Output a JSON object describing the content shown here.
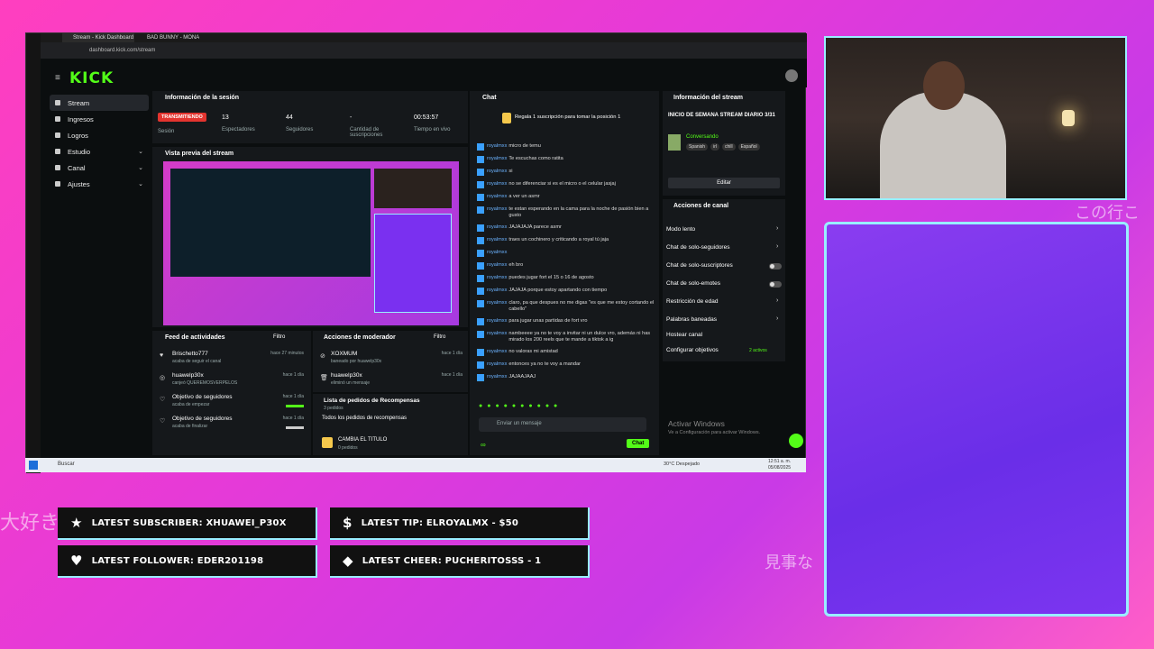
{
  "browser": {
    "tabs": [
      "Stream - Kick Dashboard",
      "BAD BUNNY - MONA..."
    ],
    "url": "dashboard.kick.com/stream"
  },
  "nav": {
    "logo": "KICK",
    "items": [
      {
        "label": "Stream",
        "active": true
      },
      {
        "label": "Ingresos"
      },
      {
        "label": "Logros"
      },
      {
        "label": "Estudio",
        "chevron": "⌄"
      },
      {
        "label": "Canal",
        "chevron": "⌄"
      },
      {
        "label": "Ajustes",
        "chevron": "⌄"
      }
    ]
  },
  "session": {
    "title": "Información de la sesión",
    "status": "TRANSMITIENDO",
    "status_label": "Sesión",
    "stats": [
      {
        "value": "13",
        "label": "Espectadores"
      },
      {
        "value": "44",
        "label": "Seguidores"
      },
      {
        "value": "-",
        "label": "Cantidad de suscripciones"
      },
      {
        "value": "00:53:57",
        "label": "Tiempo en vivo"
      }
    ]
  },
  "preview": {
    "title": "Vista previa del stream"
  },
  "activity": {
    "title": "Feed de actividades",
    "filter": "Filtro",
    "items": [
      {
        "name": "Brischetto777",
        "detail": "acaba de seguir el canal",
        "time": "hace 27 minutos"
      },
      {
        "name": "huawelp30x",
        "detail": "canjeó QUEREMOSVERPELOS",
        "time": "hace 1 día"
      },
      {
        "name": "Objetivo de seguidores",
        "detail": "acaba de empezar",
        "time": "hace 1 día"
      },
      {
        "name": "Objetivo de seguidores",
        "detail": "acaba de finalizar",
        "time": "hace 1 día"
      }
    ]
  },
  "moderator": {
    "title": "Acciones de moderador",
    "filter": "Filtro",
    "items": [
      {
        "name": "XOXMUM",
        "detail": "baneado por huawelp30x",
        "time": "hace 1 día"
      },
      {
        "name": "huawelp30x",
        "detail": "eliminó un mensaje",
        "time": "hace 1 día"
      }
    ]
  },
  "rewards": {
    "title": "Lista de pedidos de Recompensas",
    "count": "3 pedidos",
    "all_label": "Todos los pedidos de recompensas",
    "item_title": "CAMBIA EL TITULO",
    "item_count": "0 pedidos"
  },
  "chat": {
    "title": "Chat",
    "pinned": "Regala 1 suscripción para tomar la posición 1",
    "user": "royalmxx",
    "messages": [
      "micro de temu",
      "Te escuchas como ratita",
      "si",
      "no se diferenciar si es el micro o el celular jasjaj",
      "a ver un asmr",
      "te estan esperando en la cama para la noche de pasión bien a gusto",
      "JAJAJAJA parece asmr",
      "traes un cochinero y criticando a royal tú jaja",
      "",
      "eh bro",
      "puedes jugar fort el 15 o 16 de agosto",
      "JAJAJA porque estoy apartando con tiempo",
      "claro, pa que despues no me digas \"es que me estoy cortando el cabello\"",
      "para jugar unas partidas de fort vro",
      "nambeeee ya no te voy a invitar ni un dulce vro, además ni has mirado los 200 reels que te mande a tiktok a ig",
      "no valoras mi amistad",
      "entonces ya no te voy a mandar",
      "JAJAAJAAJ"
    ],
    "input_placeholder": "Enviar un mensaje",
    "send": "Chat",
    "count_label": "∞"
  },
  "streaminfo": {
    "title": "Información del stream",
    "stream_title": "INICIO DE SEMANA STREAM DIARIO 3/31",
    "category": "Conversando",
    "tags": [
      "Spanish",
      "irl",
      "chill",
      "Español"
    ],
    "edit": "Editar"
  },
  "channel_actions": {
    "title": "Acciones de canal",
    "items": [
      {
        "label": "Modo lento",
        "control": "chevron"
      },
      {
        "label": "Chat de solo-seguidores",
        "control": "chevron"
      },
      {
        "label": "Chat de solo-suscriptores",
        "control": "toggle"
      },
      {
        "label": "Chat de solo-emotes",
        "control": "toggle"
      },
      {
        "label": "Restricción de edad",
        "control": "chevron"
      },
      {
        "label": "Palabras baneadas",
        "control": "chevron"
      },
      {
        "label": "Hostear canal",
        "control": "none"
      },
      {
        "label": "Configurar objetivos",
        "control": "goals",
        "extra": "2 activos"
      }
    ]
  },
  "windows_watermark": {
    "line1": "Activar Windows",
    "line2": "Ve a Configuración para activar Windows."
  },
  "taskbar": {
    "search": "Buscar",
    "weather": "30°C  Despejado",
    "time": "12:51 a. m.",
    "date": "05/08/2025"
  },
  "alerts": [
    {
      "icon": "★",
      "text": "LATEST SUBSCRIBER: XHUAWEI_P30X"
    },
    {
      "icon": "$",
      "text": "LATEST TIP: ELROYALMX - $50"
    },
    {
      "icon": "♥",
      "text": "LATEST FOLLOWER: EDER201198"
    },
    {
      "icon": "◆",
      "text": "LATEST CHEER: PUCHERITOSSS - 1"
    }
  ],
  "overlay_text": [
    "大好き",
    "この行こ",
    "見事な"
  ],
  "colors": {
    "kick_green": "#53fc18",
    "accent_cyan": "#99eeff",
    "live_red": "#e3342f"
  }
}
